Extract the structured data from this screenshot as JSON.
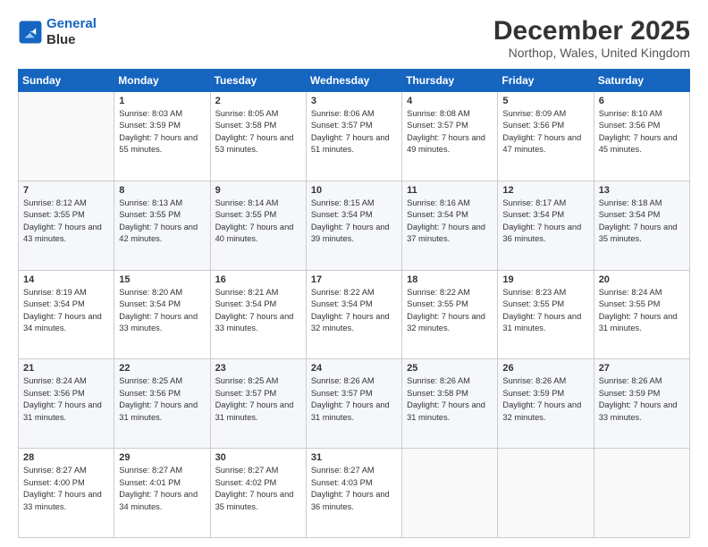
{
  "logo": {
    "line1": "General",
    "line2": "Blue"
  },
  "title": "December 2025",
  "subtitle": "Northop, Wales, United Kingdom",
  "days": [
    "Sunday",
    "Monday",
    "Tuesday",
    "Wednesday",
    "Thursday",
    "Friday",
    "Saturday"
  ],
  "weeks": [
    [
      {
        "date": "",
        "sunrise": "",
        "sunset": "",
        "daylight": ""
      },
      {
        "date": "1",
        "sunrise": "Sunrise: 8:03 AM",
        "sunset": "Sunset: 3:59 PM",
        "daylight": "Daylight: 7 hours and 55 minutes."
      },
      {
        "date": "2",
        "sunrise": "Sunrise: 8:05 AM",
        "sunset": "Sunset: 3:58 PM",
        "daylight": "Daylight: 7 hours and 53 minutes."
      },
      {
        "date": "3",
        "sunrise": "Sunrise: 8:06 AM",
        "sunset": "Sunset: 3:57 PM",
        "daylight": "Daylight: 7 hours and 51 minutes."
      },
      {
        "date": "4",
        "sunrise": "Sunrise: 8:08 AM",
        "sunset": "Sunset: 3:57 PM",
        "daylight": "Daylight: 7 hours and 49 minutes."
      },
      {
        "date": "5",
        "sunrise": "Sunrise: 8:09 AM",
        "sunset": "Sunset: 3:56 PM",
        "daylight": "Daylight: 7 hours and 47 minutes."
      },
      {
        "date": "6",
        "sunrise": "Sunrise: 8:10 AM",
        "sunset": "Sunset: 3:56 PM",
        "daylight": "Daylight: 7 hours and 45 minutes."
      }
    ],
    [
      {
        "date": "7",
        "sunrise": "Sunrise: 8:12 AM",
        "sunset": "Sunset: 3:55 PM",
        "daylight": "Daylight: 7 hours and 43 minutes."
      },
      {
        "date": "8",
        "sunrise": "Sunrise: 8:13 AM",
        "sunset": "Sunset: 3:55 PM",
        "daylight": "Daylight: 7 hours and 42 minutes."
      },
      {
        "date": "9",
        "sunrise": "Sunrise: 8:14 AM",
        "sunset": "Sunset: 3:55 PM",
        "daylight": "Daylight: 7 hours and 40 minutes."
      },
      {
        "date": "10",
        "sunrise": "Sunrise: 8:15 AM",
        "sunset": "Sunset: 3:54 PM",
        "daylight": "Daylight: 7 hours and 39 minutes."
      },
      {
        "date": "11",
        "sunrise": "Sunrise: 8:16 AM",
        "sunset": "Sunset: 3:54 PM",
        "daylight": "Daylight: 7 hours and 37 minutes."
      },
      {
        "date": "12",
        "sunrise": "Sunrise: 8:17 AM",
        "sunset": "Sunset: 3:54 PM",
        "daylight": "Daylight: 7 hours and 36 minutes."
      },
      {
        "date": "13",
        "sunrise": "Sunrise: 8:18 AM",
        "sunset": "Sunset: 3:54 PM",
        "daylight": "Daylight: 7 hours and 35 minutes."
      }
    ],
    [
      {
        "date": "14",
        "sunrise": "Sunrise: 8:19 AM",
        "sunset": "Sunset: 3:54 PM",
        "daylight": "Daylight: 7 hours and 34 minutes."
      },
      {
        "date": "15",
        "sunrise": "Sunrise: 8:20 AM",
        "sunset": "Sunset: 3:54 PM",
        "daylight": "Daylight: 7 hours and 33 minutes."
      },
      {
        "date": "16",
        "sunrise": "Sunrise: 8:21 AM",
        "sunset": "Sunset: 3:54 PM",
        "daylight": "Daylight: 7 hours and 33 minutes."
      },
      {
        "date": "17",
        "sunrise": "Sunrise: 8:22 AM",
        "sunset": "Sunset: 3:54 PM",
        "daylight": "Daylight: 7 hours and 32 minutes."
      },
      {
        "date": "18",
        "sunrise": "Sunrise: 8:22 AM",
        "sunset": "Sunset: 3:55 PM",
        "daylight": "Daylight: 7 hours and 32 minutes."
      },
      {
        "date": "19",
        "sunrise": "Sunrise: 8:23 AM",
        "sunset": "Sunset: 3:55 PM",
        "daylight": "Daylight: 7 hours and 31 minutes."
      },
      {
        "date": "20",
        "sunrise": "Sunrise: 8:24 AM",
        "sunset": "Sunset: 3:55 PM",
        "daylight": "Daylight: 7 hours and 31 minutes."
      }
    ],
    [
      {
        "date": "21",
        "sunrise": "Sunrise: 8:24 AM",
        "sunset": "Sunset: 3:56 PM",
        "daylight": "Daylight: 7 hours and 31 minutes."
      },
      {
        "date": "22",
        "sunrise": "Sunrise: 8:25 AM",
        "sunset": "Sunset: 3:56 PM",
        "daylight": "Daylight: 7 hours and 31 minutes."
      },
      {
        "date": "23",
        "sunrise": "Sunrise: 8:25 AM",
        "sunset": "Sunset: 3:57 PM",
        "daylight": "Daylight: 7 hours and 31 minutes."
      },
      {
        "date": "24",
        "sunrise": "Sunrise: 8:26 AM",
        "sunset": "Sunset: 3:57 PM",
        "daylight": "Daylight: 7 hours and 31 minutes."
      },
      {
        "date": "25",
        "sunrise": "Sunrise: 8:26 AM",
        "sunset": "Sunset: 3:58 PM",
        "daylight": "Daylight: 7 hours and 31 minutes."
      },
      {
        "date": "26",
        "sunrise": "Sunrise: 8:26 AM",
        "sunset": "Sunset: 3:59 PM",
        "daylight": "Daylight: 7 hours and 32 minutes."
      },
      {
        "date": "27",
        "sunrise": "Sunrise: 8:26 AM",
        "sunset": "Sunset: 3:59 PM",
        "daylight": "Daylight: 7 hours and 33 minutes."
      }
    ],
    [
      {
        "date": "28",
        "sunrise": "Sunrise: 8:27 AM",
        "sunset": "Sunset: 4:00 PM",
        "daylight": "Daylight: 7 hours and 33 minutes."
      },
      {
        "date": "29",
        "sunrise": "Sunrise: 8:27 AM",
        "sunset": "Sunset: 4:01 PM",
        "daylight": "Daylight: 7 hours and 34 minutes."
      },
      {
        "date": "30",
        "sunrise": "Sunrise: 8:27 AM",
        "sunset": "Sunset: 4:02 PM",
        "daylight": "Daylight: 7 hours and 35 minutes."
      },
      {
        "date": "31",
        "sunrise": "Sunrise: 8:27 AM",
        "sunset": "Sunset: 4:03 PM",
        "daylight": "Daylight: 7 hours and 36 minutes."
      },
      {
        "date": "",
        "sunrise": "",
        "sunset": "",
        "daylight": ""
      },
      {
        "date": "",
        "sunrise": "",
        "sunset": "",
        "daylight": ""
      },
      {
        "date": "",
        "sunrise": "",
        "sunset": "",
        "daylight": ""
      }
    ]
  ]
}
